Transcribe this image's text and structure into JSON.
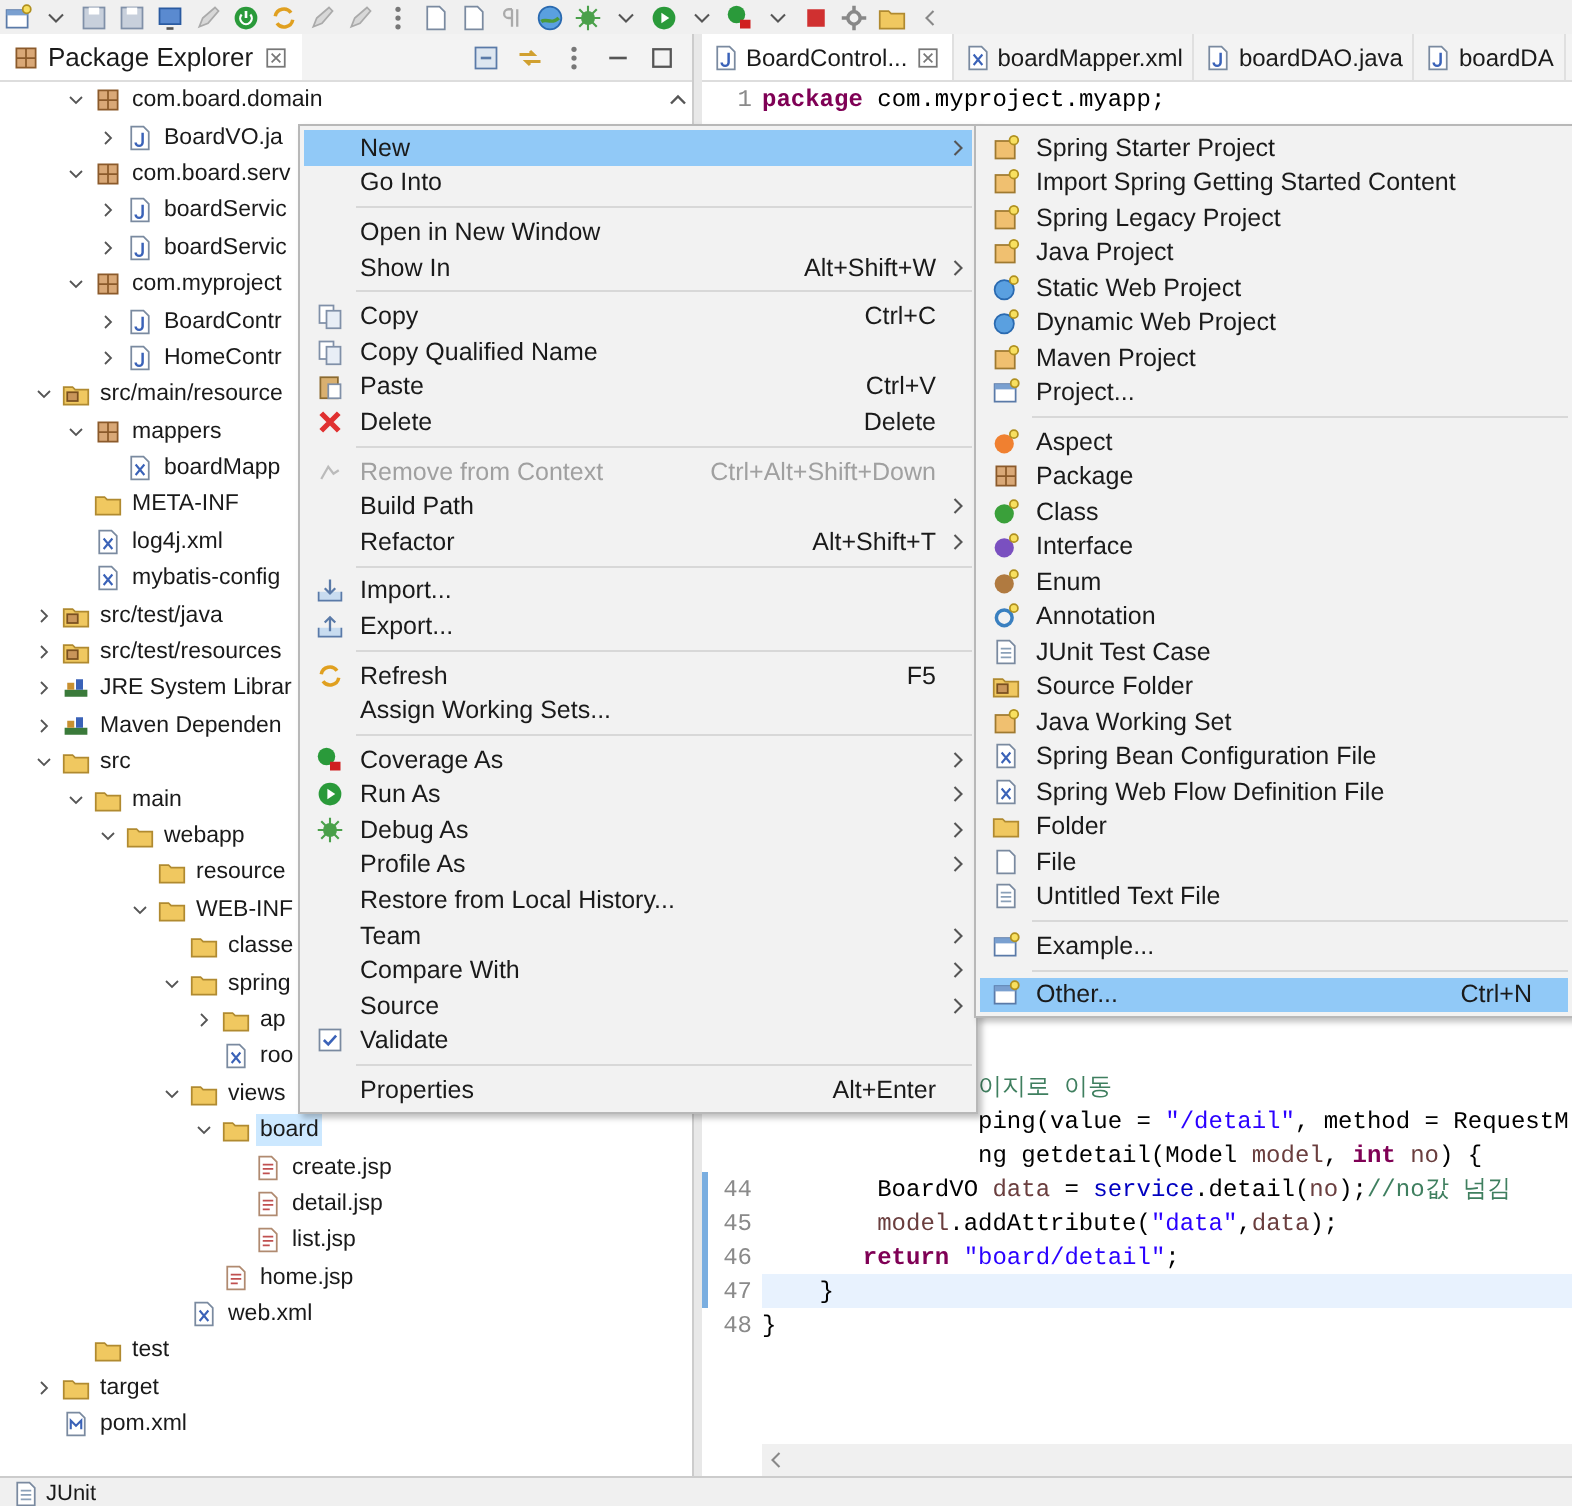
{
  "explorer": {
    "title": "Package Explorer",
    "tree": {
      "orphans": [
        {
          "label": "com.board.domain",
          "kind": "package",
          "leaf": false,
          "expanded": true,
          "selected": false,
          "children": [
            {
              "label": "BoardVO.ja",
              "kind": "java",
              "leaf": false,
              "expanded": false,
              "selected": false
            }
          ]
        },
        {
          "label": "com.board.serv",
          "kind": "package",
          "leaf": false,
          "expanded": true,
          "selected": false,
          "children": [
            {
              "label": "boardServic",
              "kind": "java",
              "leaf": false,
              "expanded": false,
              "selected": false
            },
            {
              "label": "boardServic",
              "kind": "java",
              "leaf": false,
              "expanded": false,
              "selected": false
            }
          ]
        },
        {
          "label": "com.myproject",
          "kind": "package",
          "leaf": false,
          "expanded": true,
          "selected": false,
          "children": [
            {
              "label": "BoardContr",
              "kind": "java",
              "leaf": false,
              "expanded": false,
              "selected": false
            },
            {
              "label": "HomeContr",
              "kind": "java",
              "leaf": false,
              "expanded": false,
              "selected": false
            }
          ]
        }
      ],
      "items": [
        {
          "label": "src/main/resource",
          "kind": "source",
          "leaf": false,
          "expanded": true,
          "selected": false,
          "children": [
            {
              "label": "mappers",
              "kind": "package",
              "leaf": false,
              "expanded": true,
              "selected": false,
              "children": [
                {
                  "label": "boardMapp",
                  "kind": "xml",
                  "leaf": true,
                  "selected": false
                }
              ]
            },
            {
              "label": "META-INF",
              "kind": "folder",
              "leaf": true,
              "selected": false
            },
            {
              "label": "log4j.xml",
              "kind": "xml",
              "leaf": true,
              "selected": false
            },
            {
              "label": "mybatis-config",
              "kind": "xml",
              "leaf": true,
              "selected": false
            }
          ]
        },
        {
          "label": "src/test/java",
          "kind": "source",
          "leaf": false,
          "expanded": false,
          "selected": false
        },
        {
          "label": "src/test/resources",
          "kind": "source",
          "leaf": false,
          "expanded": false,
          "selected": false
        },
        {
          "label": "JRE System Librar",
          "kind": "library",
          "leaf": false,
          "expanded": false,
          "selected": false
        },
        {
          "label": "Maven Dependen",
          "kind": "library",
          "leaf": false,
          "expanded": false,
          "selected": false
        },
        {
          "label": "src",
          "kind": "folder",
          "leaf": false,
          "expanded": true,
          "selected": false,
          "children": [
            {
              "label": "main",
              "kind": "folder",
              "leaf": false,
              "expanded": true,
              "selected": false,
              "children": [
                {
                  "label": "webapp",
                  "kind": "folder",
                  "leaf": false,
                  "expanded": true,
                  "selected": false,
                  "children": [
                    {
                      "label": "resource",
                      "kind": "folder",
                      "leaf": true,
                      "selected": false
                    },
                    {
                      "label": "WEB-INF",
                      "kind": "folder",
                      "leaf": false,
                      "expanded": true,
                      "selected": false,
                      "children": [
                        {
                          "label": "classe",
                          "kind": "folder",
                          "leaf": true,
                          "selected": false
                        },
                        {
                          "label": "spring",
                          "kind": "folder",
                          "leaf": false,
                          "expanded": true,
                          "selected": false,
                          "children": [
                            {
                              "label": "ap",
                              "kind": "folder",
                              "leaf": false,
                              "expanded": false,
                              "selected": false
                            },
                            {
                              "label": "roo",
                              "kind": "xml",
                              "leaf": true,
                              "selected": false
                            }
                          ]
                        },
                        {
                          "label": "views",
                          "kind": "folder",
                          "leaf": false,
                          "expanded": true,
                          "selected": false,
                          "children": [
                            {
                              "label": "board",
                              "kind": "folder",
                              "leaf": false,
                              "expanded": true,
                              "selected": true,
                              "children": [
                                {
                                  "label": "create.jsp",
                                  "kind": "jsp",
                                  "leaf": true,
                                  "selected": false
                                },
                                {
                                  "label": "detail.jsp",
                                  "kind": "jsp",
                                  "leaf": true,
                                  "selected": false
                                },
                                {
                                  "label": "list.jsp",
                                  "kind": "jsp",
                                  "leaf": true,
                                  "selected": false
                                }
                              ]
                            },
                            {
                              "label": "home.jsp",
                              "kind": "jsp",
                              "leaf": true,
                              "selected": false
                            }
                          ]
                        },
                        {
                          "label": "web.xml",
                          "kind": "xml",
                          "leaf": true,
                          "selected": false
                        }
                      ]
                    }
                  ]
                }
              ]
            },
            {
              "label": "test",
              "kind": "folder",
              "leaf": true,
              "selected": false
            }
          ]
        },
        {
          "label": "target",
          "kind": "folder",
          "leaf": false,
          "expanded": false,
          "selected": false
        },
        {
          "label": "pom.xml",
          "kind": "pom",
          "leaf": true,
          "selected": false
        }
      ]
    }
  },
  "editor": {
    "tabs": [
      {
        "label": "BoardControl...",
        "kind": "java",
        "selected": true
      },
      {
        "label": "boardMapper.xml",
        "kind": "xml",
        "selected": false
      },
      {
        "label": "boardDAO.java",
        "kind": "java",
        "selected": false
      },
      {
        "label": "boardDA",
        "kind": "java",
        "selected": false
      }
    ],
    "top_lines": [
      {
        "number": "1",
        "current": false,
        "changed": false,
        "tokens": [
          {
            "kind": "keyword",
            "text": "package"
          },
          {
            "kind": "plain",
            "text": " com.myproject.myapp;"
          }
        ]
      }
    ],
    "partial_lines": [
      {
        "current": false,
        "tokens": [
          {
            "kind": "comment",
            "text": "이지로 이동"
          }
        ]
      },
      {
        "current": false,
        "tokens": [
          {
            "kind": "plain",
            "text": "ping(value = "
          },
          {
            "kind": "string",
            "text": "\"/detail\""
          },
          {
            "kind": "plain",
            "text": ", method = RequestM"
          }
        ]
      },
      {
        "current": false,
        "tokens": [
          {
            "kind": "plain",
            "text": "ng getdetail(Model "
          },
          {
            "kind": "variable",
            "text": "model"
          },
          {
            "kind": "plain",
            "text": ", "
          },
          {
            "kind": "keyword",
            "text": "int"
          },
          {
            "kind": "variable",
            "text": " no"
          },
          {
            "kind": "plain",
            "text": ") {"
          }
        ]
      }
    ],
    "bottom_lines": [
      {
        "number": "44",
        "current": false,
        "changed": true,
        "tokens": [
          {
            "kind": "plain",
            "text": "        BoardVO "
          },
          {
            "kind": "variable",
            "text": "data"
          },
          {
            "kind": "plain",
            "text": " = "
          },
          {
            "kind": "field",
            "text": "service"
          },
          {
            "kind": "plain",
            "text": ".detail("
          },
          {
            "kind": "variable",
            "text": "no"
          },
          {
            "kind": "plain",
            "text": ");"
          },
          {
            "kind": "comment",
            "text": "//no값 넘김"
          }
        ]
      },
      {
        "number": "45",
        "current": false,
        "changed": true,
        "tokens": [
          {
            "kind": "variable",
            "text": "        model"
          },
          {
            "kind": "plain",
            "text": ".addAttribute("
          },
          {
            "kind": "string",
            "text": "\"data\""
          },
          {
            "kind": "plain",
            "text": ","
          },
          {
            "kind": "variable",
            "text": "data"
          },
          {
            "kind": "plain",
            "text": ");"
          }
        ]
      },
      {
        "number": "46",
        "current": false,
        "changed": true,
        "tokens": [
          {
            "kind": "keyword",
            "text": "       return"
          },
          {
            "kind": "string",
            "text": " \"board/detail\""
          },
          {
            "kind": "plain",
            "text": ";"
          }
        ]
      },
      {
        "number": "47",
        "current": true,
        "changed": true,
        "tokens": [
          {
            "kind": "plain",
            "text": "    }"
          }
        ]
      },
      {
        "number": "48",
        "current": false,
        "changed": false,
        "tokens": [
          {
            "kind": "plain",
            "text": "}"
          }
        ]
      }
    ]
  },
  "context_menu": {
    "items": [
      {
        "kind": "item",
        "label": "New",
        "submenu": true,
        "disabled": false,
        "selected": true
      },
      {
        "kind": "item",
        "label": "Go Into",
        "submenu": false,
        "disabled": false,
        "selected": false
      },
      {
        "kind": "separator"
      },
      {
        "kind": "item",
        "label": "Open in New Window",
        "submenu": false,
        "disabled": false,
        "selected": false
      },
      {
        "kind": "item",
        "label": "Show In",
        "shortcut": "Alt+Shift+W",
        "submenu": true,
        "disabled": false,
        "selected": false
      },
      {
        "kind": "separator"
      },
      {
        "kind": "item",
        "label": "Copy",
        "shortcut": "Ctrl+C",
        "submenu": false,
        "disabled": false,
        "selected": false
      },
      {
        "kind": "item",
        "label": "Copy Qualified Name",
        "submenu": false,
        "disabled": false,
        "selected": false
      },
      {
        "kind": "item",
        "label": "Paste",
        "shortcut": "Ctrl+V",
        "submenu": false,
        "disabled": false,
        "selected": false
      },
      {
        "kind": "item",
        "label": "Delete",
        "shortcut": "Delete",
        "submenu": false,
        "disabled": false,
        "selected": false
      },
      {
        "kind": "separator"
      },
      {
        "kind": "item",
        "label": "Remove from Context",
        "shortcut": "Ctrl+Alt+Shift+Down",
        "submenu": false,
        "disabled": true,
        "selected": false
      },
      {
        "kind": "item",
        "label": "Build Path",
        "submenu": true,
        "disabled": false,
        "selected": false
      },
      {
        "kind": "item",
        "label": "Refactor",
        "shortcut": "Alt+Shift+T",
        "submenu": true,
        "disabled": false,
        "selected": false
      },
      {
        "kind": "separator"
      },
      {
        "kind": "item",
        "label": "Import...",
        "submenu": false,
        "disabled": false,
        "selected": false
      },
      {
        "kind": "item",
        "label": "Export...",
        "submenu": false,
        "disabled": false,
        "selected": false
      },
      {
        "kind": "separator"
      },
      {
        "kind": "item",
        "label": "Refresh",
        "shortcut": "F5",
        "submenu": false,
        "disabled": false,
        "selected": false
      },
      {
        "kind": "item",
        "label": "Assign Working Sets...",
        "submenu": false,
        "disabled": false,
        "selected": false
      },
      {
        "kind": "separator"
      },
      {
        "kind": "item",
        "label": "Coverage As",
        "submenu": true,
        "disabled": false,
        "selected": false
      },
      {
        "kind": "item",
        "label": "Run As",
        "submenu": true,
        "disabled": false,
        "selected": false
      },
      {
        "kind": "item",
        "label": "Debug As",
        "submenu": true,
        "disabled": false,
        "selected": false
      },
      {
        "kind": "item",
        "label": "Profile As",
        "submenu": true,
        "disabled": false,
        "selected": false
      },
      {
        "kind": "item",
        "label": "Restore from Local History...",
        "submenu": false,
        "disabled": false,
        "selected": false
      },
      {
        "kind": "item",
        "label": "Team",
        "submenu": true,
        "disabled": false,
        "selected": false
      },
      {
        "kind": "item",
        "label": "Compare With",
        "submenu": true,
        "disabled": false,
        "selected": false
      },
      {
        "kind": "item",
        "label": "Source",
        "submenu": true,
        "disabled": false,
        "selected": false
      },
      {
        "kind": "item",
        "label": "Validate",
        "submenu": false,
        "disabled": false,
        "selected": false
      },
      {
        "kind": "separator"
      },
      {
        "kind": "item",
        "label": "Properties",
        "shortcut": "Alt+Enter",
        "submenu": false,
        "disabled": false,
        "selected": false
      }
    ]
  },
  "new_submenu": {
    "items": [
      {
        "kind": "item",
        "label": "Spring Starter Project",
        "selected": false
      },
      {
        "kind": "item",
        "label": "Import Spring Getting Started Content",
        "selected": false
      },
      {
        "kind": "item",
        "label": "Spring Legacy Project",
        "selected": false
      },
      {
        "kind": "item",
        "label": "Java Project",
        "selected": false
      },
      {
        "kind": "item",
        "label": "Static Web Project",
        "selected": false
      },
      {
        "kind": "item",
        "label": "Dynamic Web Project",
        "selected": false
      },
      {
        "kind": "item",
        "label": "Maven Project",
        "selected": false
      },
      {
        "kind": "item",
        "label": "Project...",
        "selected": false
      },
      {
        "kind": "separator"
      },
      {
        "kind": "item",
        "label": "Aspect",
        "selected": false
      },
      {
        "kind": "item",
        "label": "Package",
        "selected": false
      },
      {
        "kind": "item",
        "label": "Class",
        "selected": false
      },
      {
        "kind": "item",
        "label": "Interface",
        "selected": false
      },
      {
        "kind": "item",
        "label": "Enum",
        "selected": false
      },
      {
        "kind": "item",
        "label": "Annotation",
        "selected": false
      },
      {
        "kind": "item",
        "label": "JUnit Test Case",
        "selected": false
      },
      {
        "kind": "item",
        "label": "Source Folder",
        "selected": false
      },
      {
        "kind": "item",
        "label": "Java Working Set",
        "selected": false
      },
      {
        "kind": "item",
        "label": "Spring Bean Configuration File",
        "selected": false
      },
      {
        "kind": "item",
        "label": "Spring Web Flow Definition File",
        "selected": false
      },
      {
        "kind": "item",
        "label": "Folder",
        "selected": false
      },
      {
        "kind": "item",
        "label": "File",
        "selected": false
      },
      {
        "kind": "item",
        "label": "Untitled Text File",
        "selected": false
      },
      {
        "kind": "separator"
      },
      {
        "kind": "item",
        "label": "Example...",
        "selected": false
      },
      {
        "kind": "separator"
      },
      {
        "kind": "item",
        "label": "Other...",
        "shortcut": "Ctrl+N",
        "selected": true
      }
    ]
  },
  "bottom_panel": {
    "tabs": [
      {
        "label": "JUnit"
      }
    ]
  }
}
